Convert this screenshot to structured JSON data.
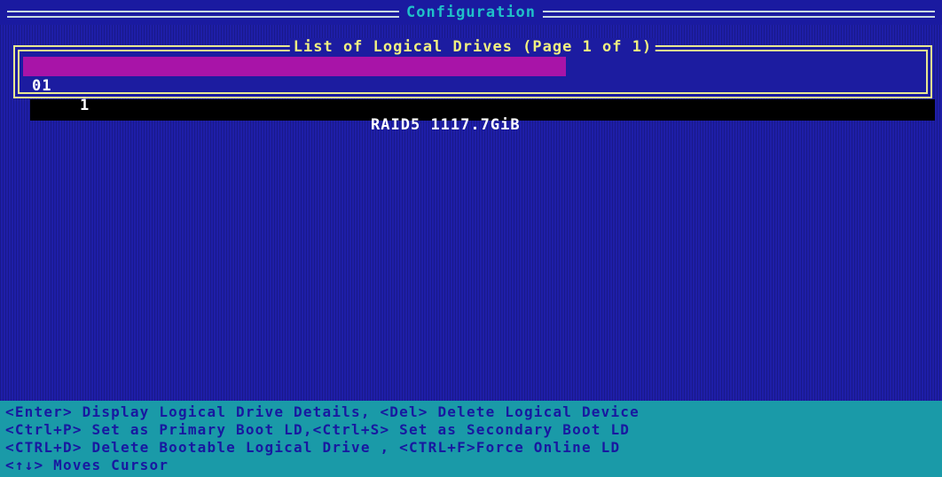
{
  "window": {
    "title": "Configuration"
  },
  "dialog": {
    "title": "List of Logical Drives (Page 1 of 1)",
    "drives": [
      {
        "id": "01",
        "num": "1",
        "raid": "RAID5",
        "size": "1117.7GiB"
      }
    ]
  },
  "help": {
    "lines": [
      "<Enter> Display Logical Drive Details, <Del> Delete Logical Device",
      "<Ctrl+P> Set as Primary Boot LD,<Ctrl+S> Set as Secondary Boot LD",
      "<CTRL+D> Delete Bootable Logical Drive , <CTRL+F>Force Online LD",
      "<↑↓> Moves Cursor"
    ]
  },
  "colors": {
    "background": "#1e1ea8",
    "selection": "#a814a8",
    "dialog_border": "#e8e890",
    "help_bg": "#1a9aa8",
    "title_text": "#20c0c8"
  }
}
